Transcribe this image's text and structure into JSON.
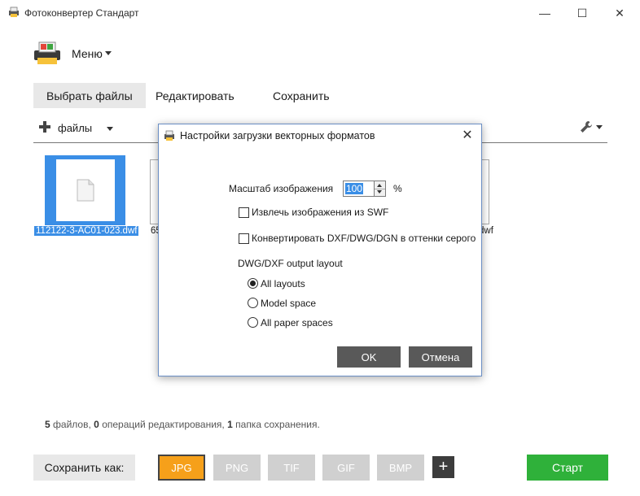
{
  "window": {
    "title": "Фотоконвертер Стандарт",
    "minimize_glyph": "—",
    "maximize_glyph": "☐",
    "close_glyph": "✕"
  },
  "menu": {
    "label": "Меню"
  },
  "tabs": [
    {
      "label": "Выбрать файлы",
      "active": true
    },
    {
      "label": "Редактировать"
    },
    {
      "label": "Сохранить"
    }
  ],
  "toolbar": {
    "files_label": "файлы"
  },
  "thumbnails": [
    {
      "label": "112122-3-AC01-023.dwf",
      "selected": true
    },
    {
      "label": "65"
    },
    {
      "label": "dwf"
    }
  ],
  "status": {
    "files_count": "5",
    "files_text": "файлов,",
    "edits_count": "0",
    "edits_text": "операций редактирования,",
    "folders_count": "1",
    "folders_text": "папка сохранения."
  },
  "bottom": {
    "save_as_label": "Сохранить как:",
    "formats": [
      "JPG",
      "PNG",
      "TIF",
      "GIF",
      "BMP"
    ],
    "selected_format": "JPG",
    "add_label": "+",
    "start_label": "Старт"
  },
  "dialog": {
    "title": "Настройки загрузки векторных форматов",
    "close_glyph": "✕",
    "scale_label": "Масштаб изображения",
    "scale_value": "100",
    "percent": "%",
    "extract_swf_label": "Извлечь изображения из SWF",
    "extract_swf_checked": false,
    "grayscale_label": "Конвертировать DXF/DWG/DGN в оттенки серого",
    "grayscale_checked": false,
    "layout_heading": "DWG/DXF output layout",
    "layout_options": [
      "All layouts",
      "Model space",
      "All paper spaces"
    ],
    "layout_selected": "All layouts",
    "ok_label": "OK",
    "cancel_label": "Отмена"
  },
  "colors": {
    "accent_orange": "#f6a01a",
    "start_green": "#2fb13a",
    "selection_blue": "#3a8ee6",
    "dialog_button": "#595959"
  }
}
